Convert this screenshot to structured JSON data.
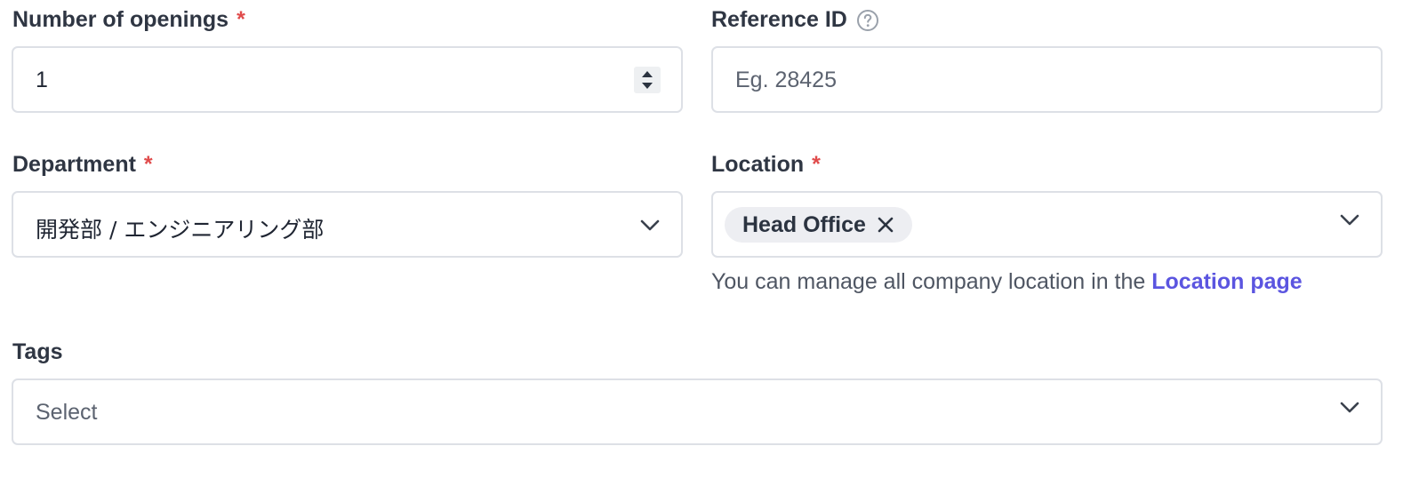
{
  "openings": {
    "label": "Number of openings",
    "required_mark": "*",
    "value": "1",
    "icons": {
      "stepper": "stepper-arrows-icon"
    }
  },
  "reference": {
    "label": "Reference ID",
    "placeholder": "Eg. 28425",
    "icons": {
      "help": "question-circle-icon"
    }
  },
  "department": {
    "label": "Department",
    "required_mark": "*",
    "value": "開発部 / エンジニアリング部",
    "icons": {
      "dropdown": "chevron-down-icon"
    }
  },
  "location": {
    "label": "Location",
    "required_mark": "*",
    "chips": [
      {
        "label": "Head Office"
      }
    ],
    "helper_text": "You can manage all company location in the ",
    "helper_link": "Location page",
    "icons": {
      "dropdown": "chevron-down-icon",
      "chip_remove": "close-icon"
    }
  },
  "tags": {
    "label": "Tags",
    "placeholder": "Select",
    "icons": {
      "dropdown": "chevron-down-icon"
    }
  },
  "colors": {
    "required": "#e04b4b",
    "link": "#5b55e0",
    "border": "#dde0e6",
    "chip_bg": "#edeef2"
  }
}
